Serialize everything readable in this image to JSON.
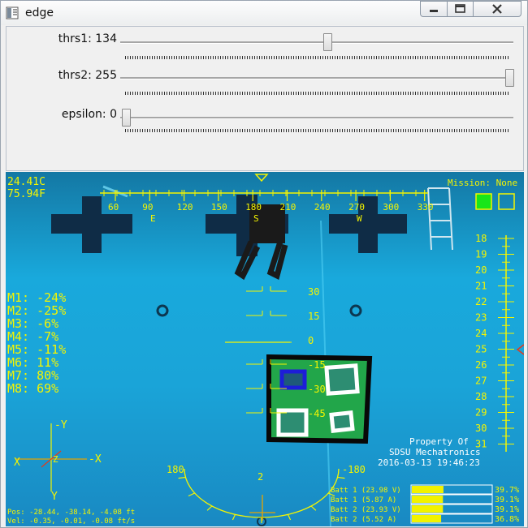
{
  "window": {
    "title": "edge"
  },
  "trackbars": [
    {
      "label": "thrs1: 134",
      "fraction": 0.525
    },
    {
      "label": "thrs2: 255",
      "fraction": 1.0
    },
    {
      "label": "epsilon: 0",
      "fraction": 0.0
    }
  ],
  "hud": {
    "temp_c": "24.41C",
    "temp_f": "75.94F",
    "mission": "Mission: None",
    "heading_ticks": [
      "60",
      "90",
      "120",
      "150",
      "180",
      "210",
      "240",
      "270",
      "300",
      "330"
    ],
    "heading_letters": [
      "E",
      "S",
      "W"
    ],
    "pitch_labels": [
      "30",
      "15",
      "0",
      "-15",
      "-30",
      "-45"
    ],
    "depth_ticks": [
      "18",
      "19",
      "20",
      "21",
      "22",
      "23",
      "24",
      "25",
      "26",
      "27",
      "28",
      "29",
      "30",
      "31"
    ],
    "motors": [
      "M1: -24%",
      "M2: -25%",
      "M3: -6%",
      "M4: -7%",
      "M5: -11%",
      "M6: 11%",
      "M7: 80%",
      "M8: 69%"
    ],
    "axis": {
      "neg_y": "-Y",
      "x": "X",
      "neg_x": "-X",
      "y": "Y",
      "z": "Z"
    },
    "roll": {
      "left": "180",
      "right": "-180",
      "bottom": "2"
    },
    "watermark": [
      "Property Of",
      "SDSU Mechatronics"
    ],
    "timestamp": "2016-03-13 19:46:23",
    "pos": "Pos: -28.44, -38.14, -4.08 ft",
    "vel": "Vel: -0.35, -0.01, -0.08 ft/s",
    "batteries": [
      {
        "label": "Batt 1 (23.98 V)",
        "percent": "39.7%",
        "level": 0.397
      },
      {
        "label": "Batt 1 (5.87 A)",
        "percent": "39.1%",
        "level": 0.391
      },
      {
        "label": "Batt 2 (23.93 V)",
        "percent": "39.1%",
        "level": 0.391
      },
      {
        "label": "Batt 2 (5.52 A)",
        "percent": "36.8%",
        "level": 0.368
      }
    ],
    "colors": {
      "hud": "#f5f500",
      "target_green": "#22a64a",
      "indicator_green": "#19e619",
      "marker_red": "#e23b1e",
      "marker_blue": "#1d1dd8"
    }
  }
}
